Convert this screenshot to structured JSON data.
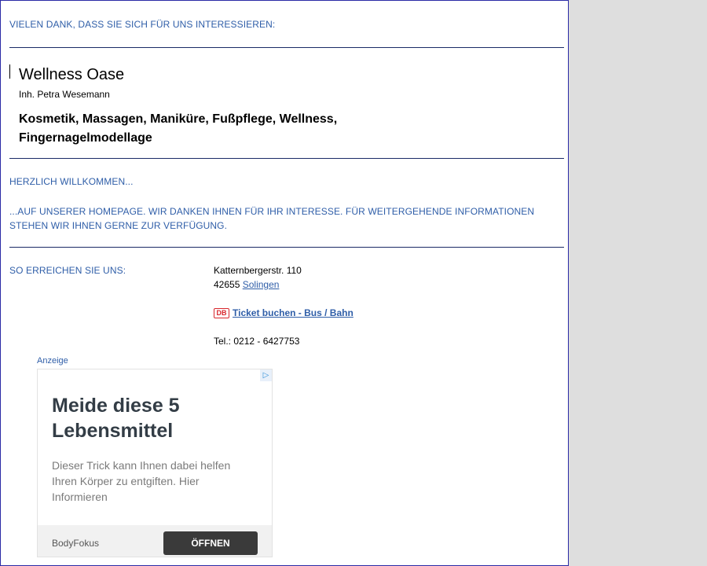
{
  "thanks_heading": "VIELEN DANK, DASS SIE SICH FÜR UNS INTERESSIEREN:",
  "business": {
    "name": "Wellness Oase",
    "owner": "Inh. Petra Wesemann",
    "services": "Kosmetik, Massagen, Maniküre, Fußpflege, Wellness, Fingernagelmodellage"
  },
  "welcome": {
    "heading": "HERZLICH WILLKOMMEN...",
    "text": "...AUF UNSERER HOMEPAGE. WIR DANKEN IHNEN FÜR IHR INTERESSE. FÜR WEITERGEHENDE INFORMATIONEN STEHEN WIR IHNEN GERNE ZUR VERFÜGUNG."
  },
  "contact": {
    "heading": "SO ERREICHEN SIE UNS:",
    "street": "Katternbergerstr. 110",
    "zip": "42655",
    "city": "Solingen",
    "db_logo": "DB",
    "ticket_link": "Ticket buchen - Bus / Bahn",
    "phone": "Tel.: 0212 - 6427753"
  },
  "ad": {
    "label": "Anzeige",
    "choice_icon": "ad-choices-icon",
    "title": "Meide diese 5 Lebensmittel",
    "body": "Dieser Trick kann Ihnen dabei helfen Ihren Körper zu entgiften. Hier Informieren",
    "brand": "BodyFokus",
    "button": "ÖFFNEN"
  },
  "colors": {
    "link_blue": "#2f5ea8",
    "rule": "#1a2a66",
    "page_border": "#2a2aa6",
    "db_red": "#d8262c",
    "side_gray": "#dedede"
  }
}
